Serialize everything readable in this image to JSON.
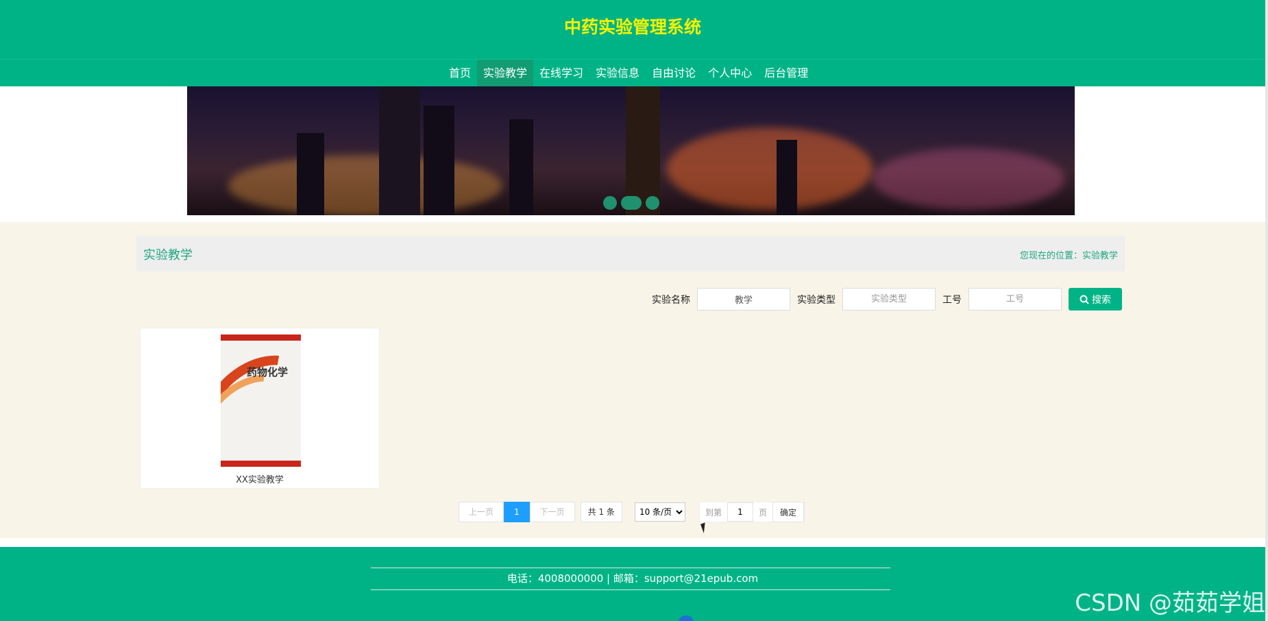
{
  "app": {
    "title": "中药实验管理系统"
  },
  "nav": {
    "items": [
      {
        "label": "首页"
      },
      {
        "label": "实验教学",
        "active": true
      },
      {
        "label": "在线学习"
      },
      {
        "label": "实验信息"
      },
      {
        "label": "自由讨论"
      },
      {
        "label": "个人中心"
      },
      {
        "label": "后台管理"
      }
    ]
  },
  "banner": {
    "slides": 3,
    "active_slide": 1
  },
  "section": {
    "title": "实验教学",
    "breadcrumb": "您现在的位置：实验教学"
  },
  "search": {
    "name_label": "实验名称",
    "name_value": "教学",
    "type_label": "实验类型",
    "type_placeholder": "实验类型",
    "id_label": "工号",
    "id_placeholder": "工号",
    "button_label": "搜索",
    "button_icon": "search-icon"
  },
  "cards": [
    {
      "cover_title": "药物化学",
      "caption": "XX实验教学"
    }
  ],
  "pagination": {
    "prev": "上一页",
    "current": "1",
    "next": "下一页",
    "total": "共 1 条",
    "page_size": "10 条/页",
    "goto_prefix": "到第",
    "goto_value": "1",
    "goto_suffix": "页",
    "confirm": "确定"
  },
  "footer": {
    "contact": "电话：4008000000 | 邮箱：support@21epub.com"
  },
  "watermark": "CSDN @茹茹学姐",
  "colors": {
    "primary": "#00b386",
    "title": "#f5f200",
    "accent_text": "#1fa67f",
    "content_bg": "#f8f4e8",
    "pager_active": "#1e9fff"
  }
}
